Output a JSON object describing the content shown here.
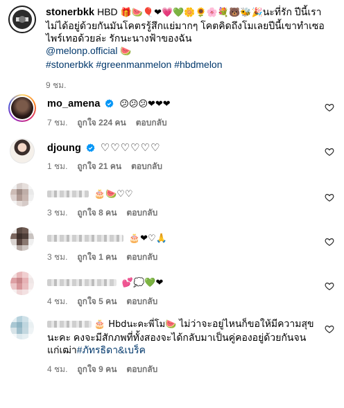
{
  "caption": {
    "username": "stonerbkk",
    "text_lead": "HBD",
    "emoji_row": "🎁🍉🎈❤💗💚🌼🌻🌸💐🐻🐝🎉",
    "text_tail": "นะที่รัก ปีนี้เราไม่ได้อยู่ด้วยกันมันโคตรรู้สึกแย่มากๆ โคตคิดถึงโมเลยปีนี้เขาทำเซอไพร์เทอด้วยล่ะ รักนะนางฟ้าของฉัน",
    "mention": "@melonp.official",
    "mention_emoji": "🍉",
    "hashtags": "#stonerbkk #greenmanmelon #hbdmelon",
    "time": "9 ชม."
  },
  "comments": [
    {
      "username": "mo_amena",
      "verified": true,
      "text": "😕😕😕❤❤❤",
      "time": "7 ชม.",
      "likes": "ถูกใจ 224 คน",
      "reply": "ตอบกลับ"
    },
    {
      "username": "djoung",
      "verified": true,
      "text": "♡♡♡♡♡♡",
      "time": "1 ชม.",
      "likes": "ถูกใจ 21 คน",
      "reply": "ตอบกลับ"
    },
    {
      "username": "",
      "text": "🎂🍉♡♡",
      "time": "3 ชม.",
      "likes": "ถูกใจ 8 คน",
      "reply": "ตอบกลับ"
    },
    {
      "username": "",
      "text": "🎂❤♡🙏",
      "time": "3 ชม.",
      "likes": "ถูกใจ 1 คน",
      "reply": "ตอบกลับ"
    },
    {
      "username": "",
      "text": "💕💭💚❤",
      "time": "4 ชม.",
      "likes": "ถูกใจ 5 คน",
      "reply": "ตอบกลับ"
    },
    {
      "username": "",
      "text_lead": "🎂 Hbdนะคะพี่โม",
      "text_emoji": "🍉",
      "text_tail": "ไม่ว่าจะอยู่ไหนก็ขอให้มีความสุขนะคะ คงจะมีสักภพที่ทั้งสองจะได้กลับมาเป็นคู่คองอยู่ด้วยกันจนแก่เฒ่า",
      "hashtag": "#ภัทรธิดา&เบร็ค",
      "time": "4 ชม.",
      "likes": "ถูกใจ 9 คน",
      "reply": "ตอบกลับ"
    }
  ],
  "icons": {
    "like": "heart-outline-icon",
    "verified": "verified-badge-icon"
  },
  "colors": {
    "link": "#00376b",
    "meta": "#737373",
    "verified": "#0095f6",
    "story_ring": "#d62976"
  }
}
